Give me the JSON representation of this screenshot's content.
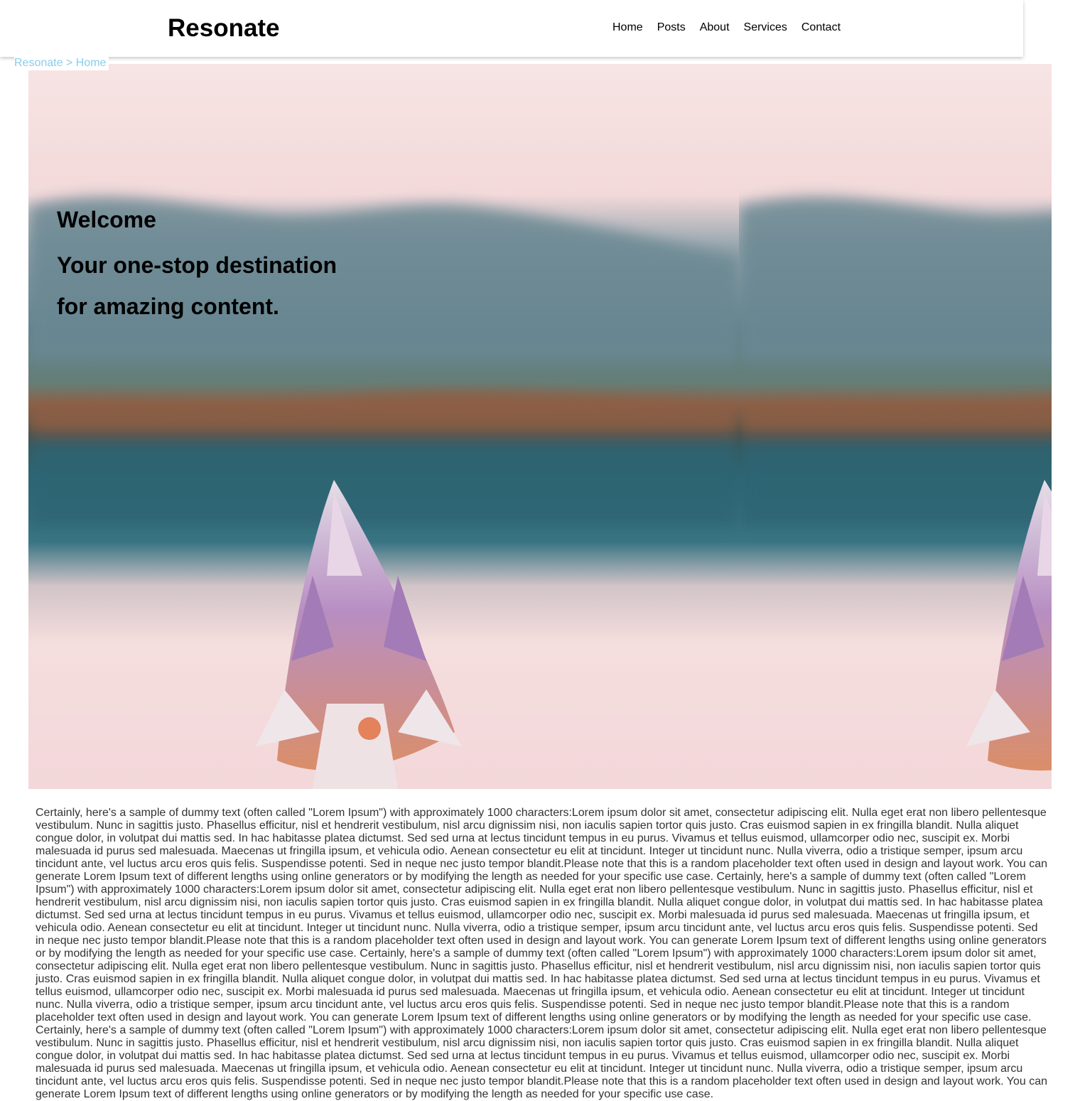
{
  "site": {
    "brand": "Resonate",
    "nav": [
      "Home",
      "Posts",
      "About",
      "Services",
      "Contact"
    ]
  },
  "breadcrumb": {
    "site": "Resonate",
    "separator": ">",
    "current": "Home"
  },
  "hero": {
    "welcome": "Welcome",
    "tagline": "Your one-stop destination for amazing content.",
    "image": "blurred-lake-with-pink-flower"
  },
  "colors": {
    "breadcrumb": "#87ceeb",
    "text": "#333333",
    "sky": "#f6dde0",
    "mountains": "#6f8e98",
    "water": "#2f6b78",
    "flower": "#b08ab8"
  },
  "content": {
    "paragraph": "Certainly, here's a sample of dummy text (often called \"Lorem Ipsum\") with approximately 1000 characters:Lorem ipsum dolor sit amet, consectetur adipiscing elit. Nulla eget erat non libero pellentesque vestibulum. Nunc in sagittis justo. Phasellus efficitur, nisl et hendrerit vestibulum, nisl arcu dignissim nisi, non iaculis sapien tortor quis justo. Cras euismod sapien in ex fringilla blandit. Nulla aliquet congue dolor, in volutpat dui mattis sed. In hac habitasse platea dictumst. Sed sed urna at lectus tincidunt tempus in eu purus. Vivamus et tellus euismod, ullamcorper odio nec, suscipit ex. Morbi malesuada id purus sed malesuada. Maecenas ut fringilla ipsum, et vehicula odio. Aenean consectetur eu elit at tincidunt. Integer ut tincidunt nunc. Nulla viverra, odio a tristique semper, ipsum arcu tincidunt ante, vel luctus arcu eros quis felis. Suspendisse potenti. Sed in neque nec justo tempor blandit.Please note that this is a random placeholder text often used in design and layout work. You can generate Lorem Ipsum text of different lengths using online generators or by modifying the length as needed for your specific use case. Certainly, here's a sample of dummy text (often called \"Lorem Ipsum\") with approximately 1000 characters:Lorem ipsum dolor sit amet, consectetur adipiscing elit. Nulla eget erat non libero pellentesque vestibulum. Nunc in sagittis justo. Phasellus efficitur, nisl et hendrerit vestibulum, nisl arcu dignissim nisi, non iaculis sapien tortor quis justo. Cras euismod sapien in ex fringilla blandit. Nulla aliquet congue dolor, in volutpat dui mattis sed. In hac habitasse platea dictumst. Sed sed urna at lectus tincidunt tempus in eu purus. Vivamus et tellus euismod, ullamcorper odio nec, suscipit ex. Morbi malesuada id purus sed malesuada. Maecenas ut fringilla ipsum, et vehicula odio. Aenean consectetur eu elit at tincidunt. Integer ut tincidunt nunc. Nulla viverra, odio a tristique semper, ipsum arcu tincidunt ante, vel luctus arcu eros quis felis. Suspendisse potenti. Sed in neque nec justo tempor blandit.Please note that this is a random placeholder text often used in design and layout work. You can generate Lorem Ipsum text of different lengths using online generators or by modifying the length as needed for your specific use case. Certainly, here's a sample of dummy text (often called \"Lorem Ipsum\") with approximately 1000 characters:Lorem ipsum dolor sit amet, consectetur adipiscing elit. Nulla eget erat non libero pellentesque vestibulum. Nunc in sagittis justo. Phasellus efficitur, nisl et hendrerit vestibulum, nisl arcu dignissim nisi, non iaculis sapien tortor quis justo. Cras euismod sapien in ex fringilla blandit. Nulla aliquet congue dolor, in volutpat dui mattis sed. In hac habitasse platea dictumst. Sed sed urna at lectus tincidunt tempus in eu purus. Vivamus et tellus euismod, ullamcorper odio nec, suscipit ex. Morbi malesuada id purus sed malesuada. Maecenas ut fringilla ipsum, et vehicula odio. Aenean consectetur eu elit at tincidunt. Integer ut tincidunt nunc. Nulla viverra, odio a tristique semper, ipsum arcu tincidunt ante, vel luctus arcu eros quis felis. Suspendisse potenti. Sed in neque nec justo tempor blandit.Please note that this is a random placeholder text often used in design and layout work. You can generate Lorem Ipsum text of different lengths using online generators or by modifying the length as needed for your specific use case. Certainly, here's a sample of dummy text (often called \"Lorem Ipsum\") with approximately 1000 characters:Lorem ipsum dolor sit amet, consectetur adipiscing elit. Nulla eget erat non libero pellentesque vestibulum. Nunc in sagittis justo. Phasellus efficitur, nisl et hendrerit vestibulum, nisl arcu dignissim nisi, non iaculis sapien tortor quis justo. Cras euismod sapien in ex fringilla blandit. Nulla aliquet congue dolor, in volutpat dui mattis sed. In hac habitasse platea dictumst. Sed sed urna at lectus tincidunt tempus in eu purus. Vivamus et tellus euismod, ullamcorper odio nec, suscipit ex. Morbi malesuada id purus sed malesuada. Maecenas ut fringilla ipsum, et vehicula odio. Aenean consectetur eu elit at tincidunt. Integer ut tincidunt nunc. Nulla viverra, odio a tristique semper, ipsum arcu tincidunt ante, vel luctus arcu eros quis felis. Suspendisse potenti. Sed in neque nec justo tempor blandit.Please note that this is a random placeholder text often used in design and layout work. You can generate Lorem Ipsum text of different lengths using online generators or by modifying the length as needed for your specific use case."
  }
}
